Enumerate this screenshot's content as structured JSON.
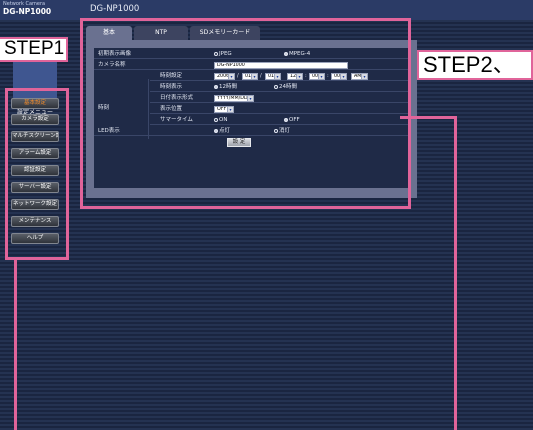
{
  "header": {
    "brand_top": "Network Camera",
    "brand_model": "DG-NP1000",
    "title": "DG-NP1000"
  },
  "sidebar": {
    "menu_title": "設定メニュー",
    "items": [
      {
        "label": "基本設定",
        "active": true
      },
      {
        "label": "カメラ設定",
        "active": false
      },
      {
        "label": "マルチスクリーン設定",
        "active": false
      },
      {
        "label": "アラーム設定",
        "active": false
      },
      {
        "label": "認証設定",
        "active": false
      },
      {
        "label": "サーバー設定",
        "active": false
      },
      {
        "label": "ネットワーク設定",
        "active": false
      },
      {
        "label": "メンテナンス",
        "active": false
      },
      {
        "label": "ヘルプ",
        "active": false
      }
    ]
  },
  "tabs": [
    {
      "label": "基本",
      "active": true
    },
    {
      "label": "NTP",
      "active": false
    },
    {
      "label": "SDメモリーカード",
      "active": false
    }
  ],
  "form": {
    "initial_image": {
      "label": "初期表示画像",
      "options": [
        {
          "label": "JPEG",
          "selected": false
        },
        {
          "label": "MPEG-4",
          "selected": true
        }
      ]
    },
    "camera_name": {
      "label": "カメラ名称",
      "value": "DG-NP1000"
    },
    "clock": {
      "group_label": "時刻",
      "time_setting": {
        "label": "時刻設定",
        "year": "2006",
        "month": "01",
        "day": "01",
        "hour": "12",
        "minute": "00",
        "second": "00",
        "ampm": "AM",
        "sep_date": "/",
        "sep_time": ":"
      },
      "time_display": {
        "label": "時刻表示",
        "options": [
          {
            "label": "12時間",
            "selected": true
          },
          {
            "label": "24時間",
            "selected": false
          }
        ]
      },
      "date_format": {
        "label": "日付表示形式",
        "value": "YYYY/MM/DD"
      },
      "display_position": {
        "label": "表示位置",
        "value": "OFF"
      },
      "summer_time": {
        "label": "サマータイム",
        "options": [
          {
            "label": "ON",
            "selected": false
          },
          {
            "label": "OFF",
            "selected": true
          }
        ]
      }
    },
    "led": {
      "label": "LED表示",
      "options": [
        {
          "label": "点灯",
          "selected": true
        },
        {
          "label": "消灯",
          "selected": false
        }
      ]
    },
    "setup_button": "設 定"
  },
  "annotations": {
    "step1": "STEP1",
    "step2": "STEP2、",
    "color": "#e0649a"
  }
}
